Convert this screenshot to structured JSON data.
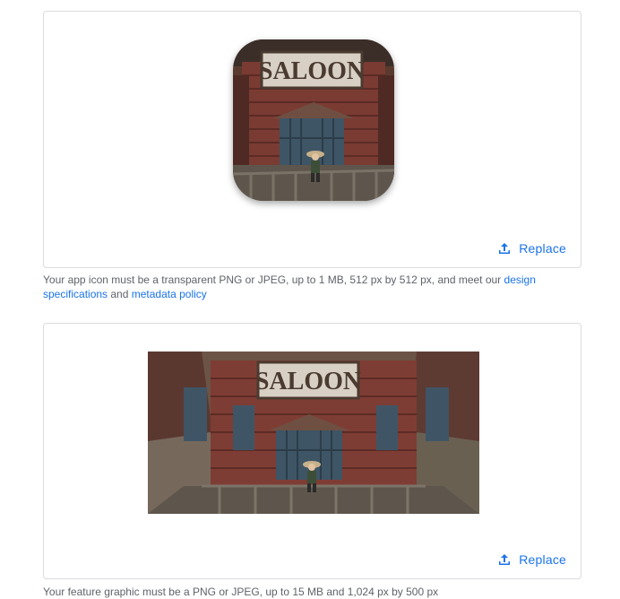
{
  "icon_card": {
    "image_sign_text": "SALOON",
    "replace_label": "Replace"
  },
  "icon_helper": {
    "text_before": "Your app icon must be a transparent PNG or JPEG, up to 1 MB, 512 px by 512 px, and meet our ",
    "link_design": "design specifications",
    "text_and": " and ",
    "link_metadata": "metadata policy"
  },
  "feature_card": {
    "image_sign_text": "SALOON",
    "replace_label": "Replace"
  },
  "feature_helper": {
    "text": "Your feature graphic must be a PNG or JPEG, up to 15 MB and 1,024 px by 500 px"
  },
  "colors": {
    "accent": "#1a73e8",
    "border": "#dadce0",
    "helper_text": "#5f6368"
  },
  "icons": [
    "upload-icon"
  ]
}
